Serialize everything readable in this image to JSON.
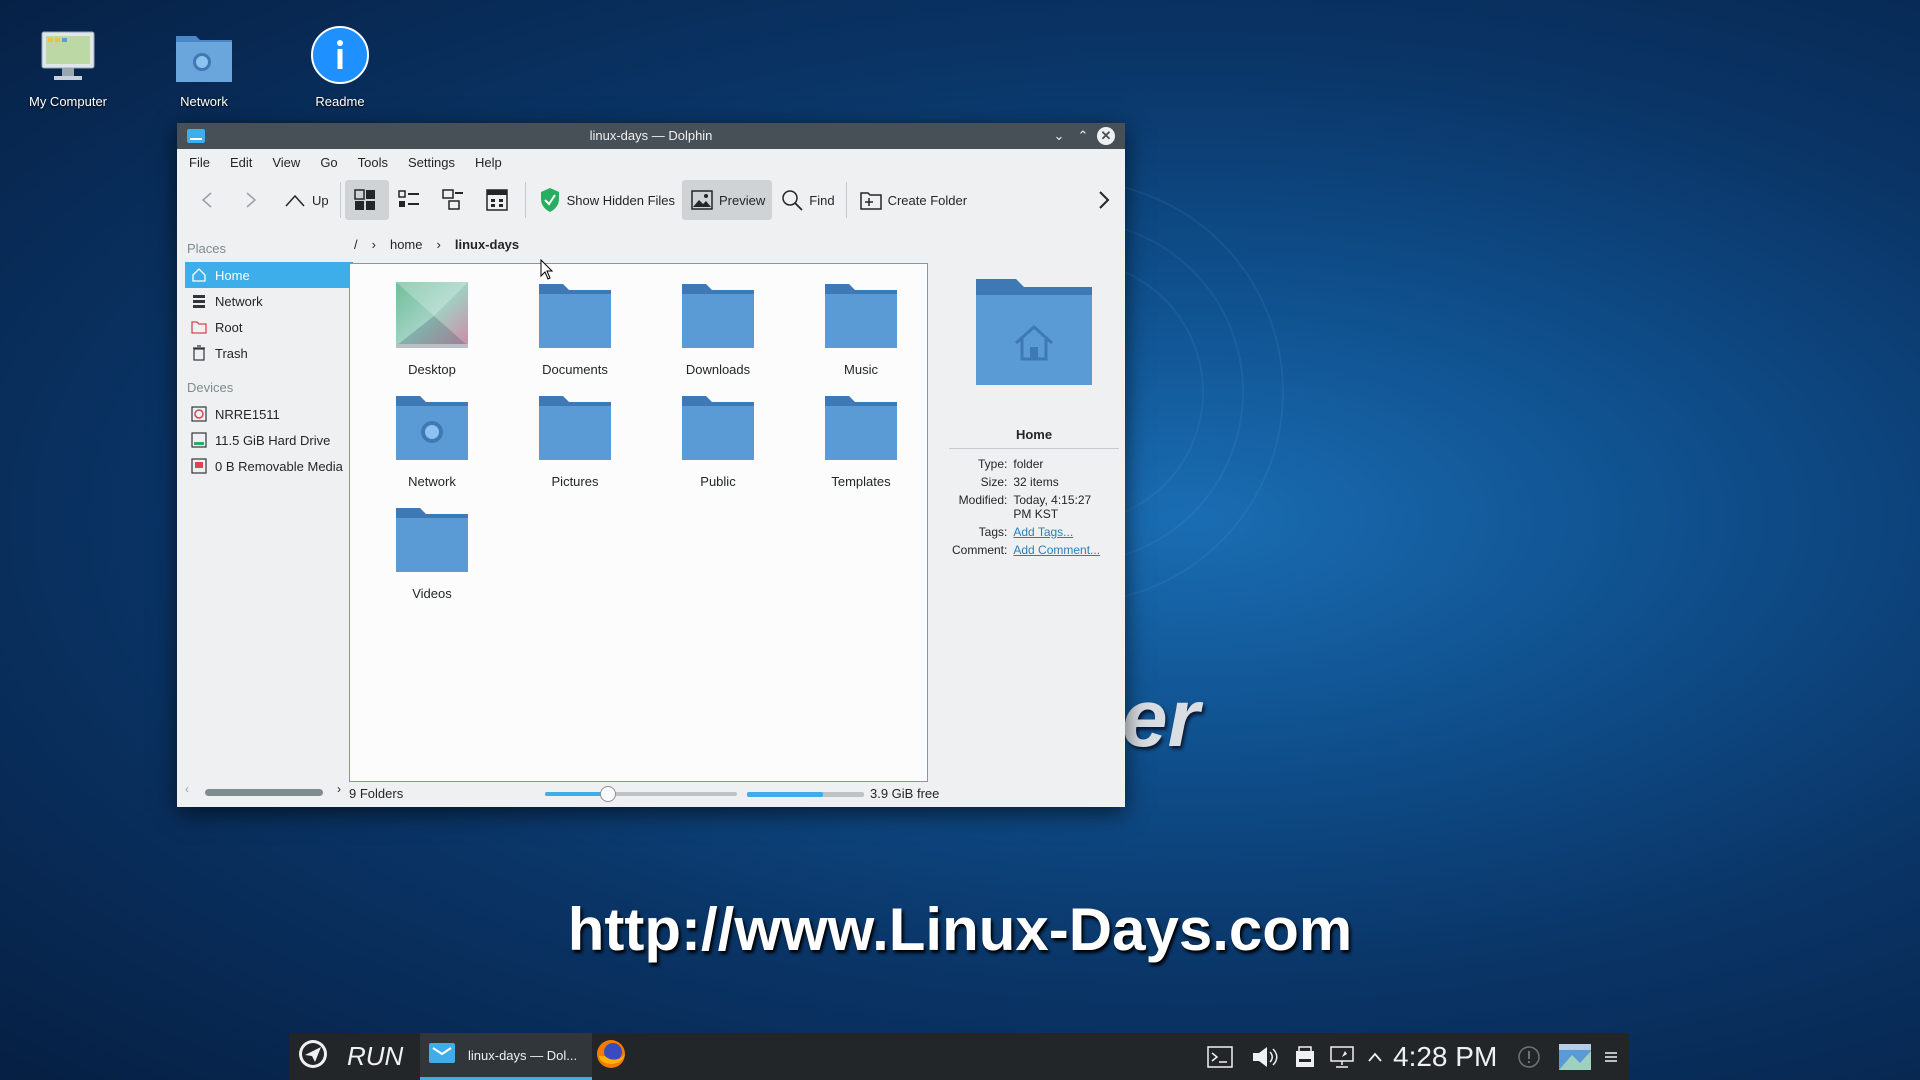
{
  "desktop": {
    "icons": [
      {
        "label": "My Computer",
        "icon": "computer-icon"
      },
      {
        "label": "Network",
        "icon": "network-folder-icon"
      },
      {
        "label": "Readme",
        "icon": "info-icon"
      }
    ],
    "watermark": "http://www.Linux-Days.com",
    "fragment": "er"
  },
  "window": {
    "title": "linux-days — Dolphin",
    "menu": [
      "File",
      "Edit",
      "View",
      "Go",
      "Tools",
      "Settings",
      "Help"
    ],
    "toolbar": {
      "up": "Up",
      "show_hidden": "Show Hidden Files",
      "preview": "Preview",
      "find": "Find",
      "create_folder": "Create Folder"
    },
    "places": {
      "header": "Places",
      "items": [
        "Home",
        "Network",
        "Root",
        "Trash"
      ],
      "devices_header": "Devices",
      "devices": [
        "NRRE1511",
        "11.5 GiB Hard Drive",
        "0 B Removable Media"
      ]
    },
    "breadcrumb": [
      "/",
      "home",
      "linux-days"
    ],
    "files": [
      "Desktop",
      "Documents",
      "Downloads",
      "Music",
      "Network",
      "Pictures",
      "Public",
      "Templates",
      "Videos"
    ],
    "status": {
      "count": "9 Folders",
      "free": "3.9 GiB free",
      "zoom_fraction": 0.33,
      "disk_used_fraction": 0.65
    },
    "info": {
      "name": "Home",
      "type_label": "Type:",
      "type": "folder",
      "size_label": "Size:",
      "size": "32 items",
      "modified_label": "Modified:",
      "modified": "Today, 4:15:27 PM KST",
      "tags_label": "Tags:",
      "tags": "Add Tags...",
      "comment_label": "Comment:",
      "comment": "Add Comment..."
    }
  },
  "taskbar": {
    "run": "RUN",
    "task": "linux-days — Dol...",
    "clock": "4:28 PM"
  },
  "colors": {
    "accent": "#3daee9",
    "folder": "#5b9bd5",
    "titlebar": "#475057",
    "panel": "#232629"
  }
}
